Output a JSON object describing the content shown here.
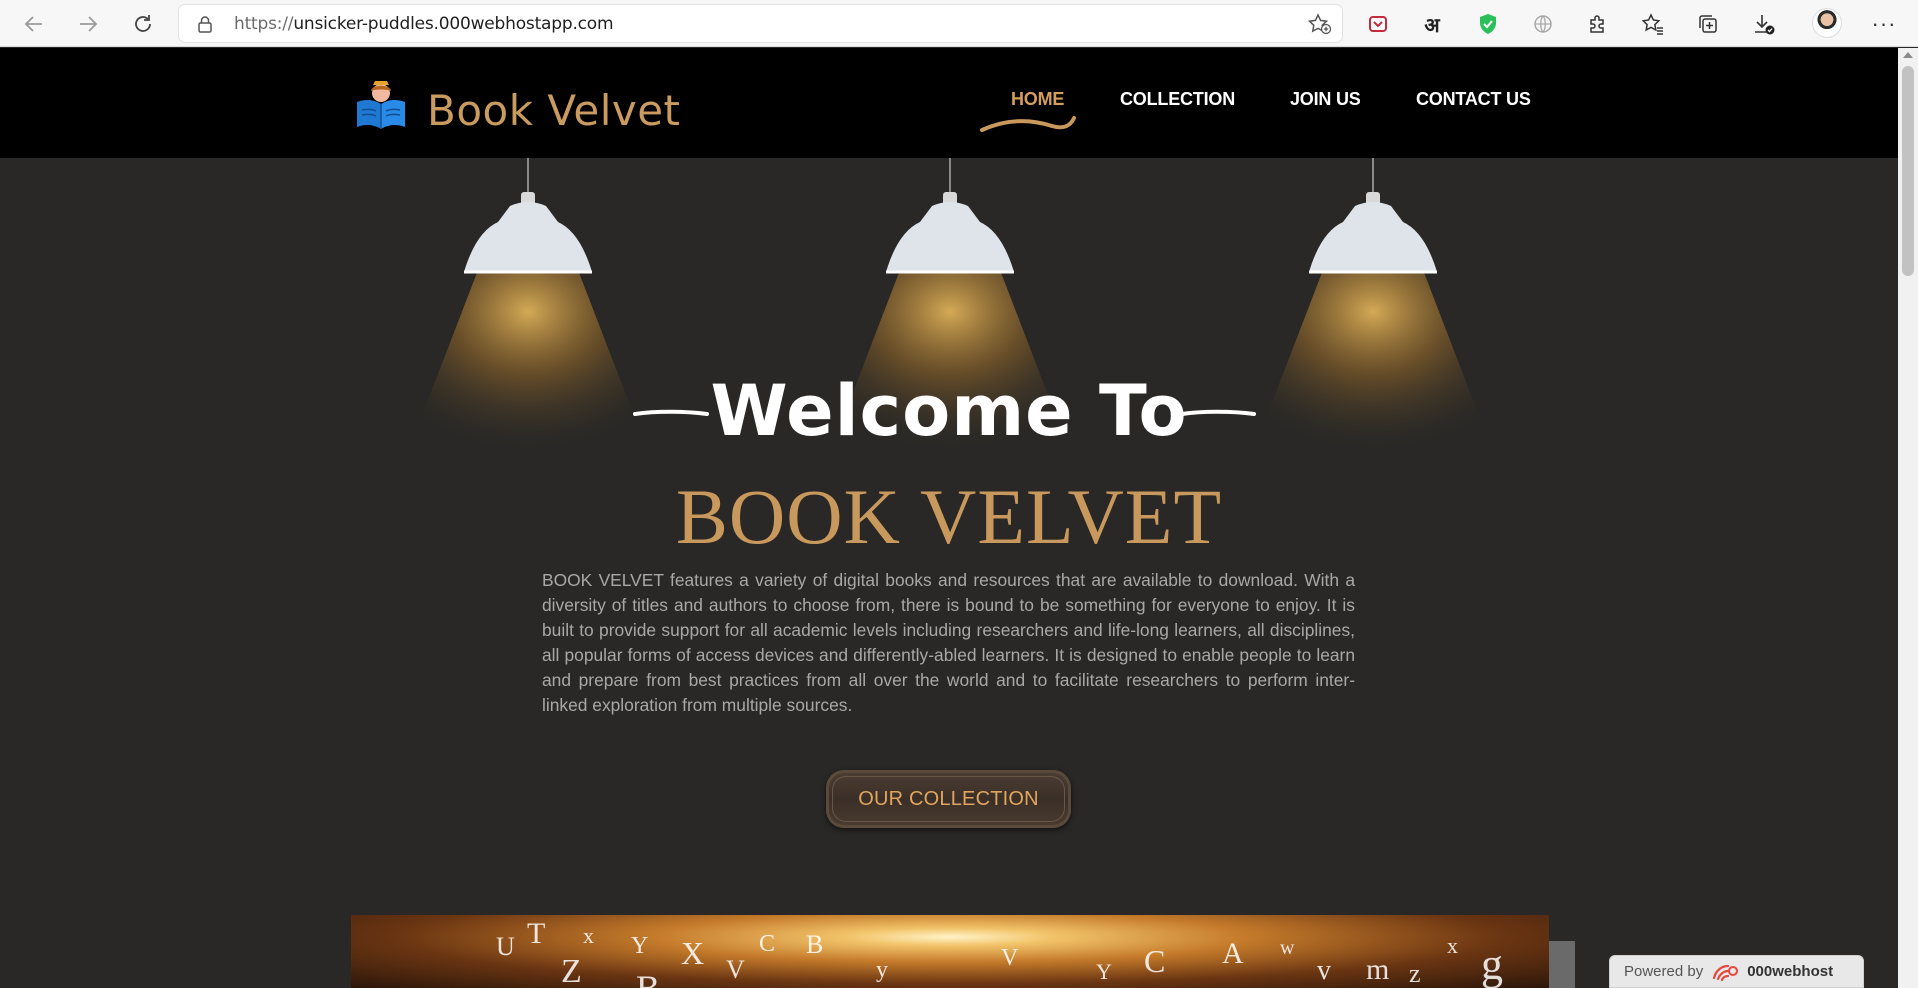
{
  "browser": {
    "url_prefix": "https://",
    "url_host": "unsicker-puddles.000webhostapp.com",
    "icons": [
      "back-icon",
      "forward-icon",
      "reload-icon",
      "lock-icon",
      "favorite-add-icon",
      "pocket-icon",
      "translate-icon",
      "shield-icon",
      "globe-icon",
      "extensions-icon",
      "favorites-icon",
      "collections-icon",
      "downloads-icon",
      "avatar",
      "more-icon"
    ],
    "translate_glyph": "अ"
  },
  "site": {
    "logo_text": "Book Velvet",
    "menu": [
      {
        "label": "HOME",
        "active": true
      },
      {
        "label": "COLLECTION",
        "active": false
      },
      {
        "label": "JOIN US",
        "active": false
      },
      {
        "label": "CONTACT US",
        "active": false
      }
    ]
  },
  "hero": {
    "welcome": "Welcome To",
    "title": "BOOK VELVET",
    "intro": "BOOK VELVET features a variety of digital books and resources that are available to download. With a diversity of titles and authors to choose from, there is bound to be something for everyone to enjoy. It is built to provide support for all academic levels including researchers and life-long learners, all disciplines, all popular forms of access devices and differently-abled learners. It is designed to enable people to learn and prepare from best practices from all over the world and to facilitate researchers to perform inter-linked exploration from multiple sources.",
    "cta_label": "OUR COLLECTION"
  },
  "banner": {
    "letters": [
      "U",
      "T",
      "x",
      "Y",
      "X",
      "C",
      "B",
      "V",
      "Y",
      "C",
      "A",
      "w",
      "v",
      "m",
      "z",
      "x",
      "g",
      "Z",
      "B",
      "y",
      "V"
    ]
  },
  "footer": {
    "powered_label": "Powered by",
    "powered_brand": "000webhost"
  },
  "colors": {
    "accent": "#c9985c",
    "menu_active": "#d49e5c",
    "header_bg": "#000000",
    "page_bg": "#292826"
  }
}
